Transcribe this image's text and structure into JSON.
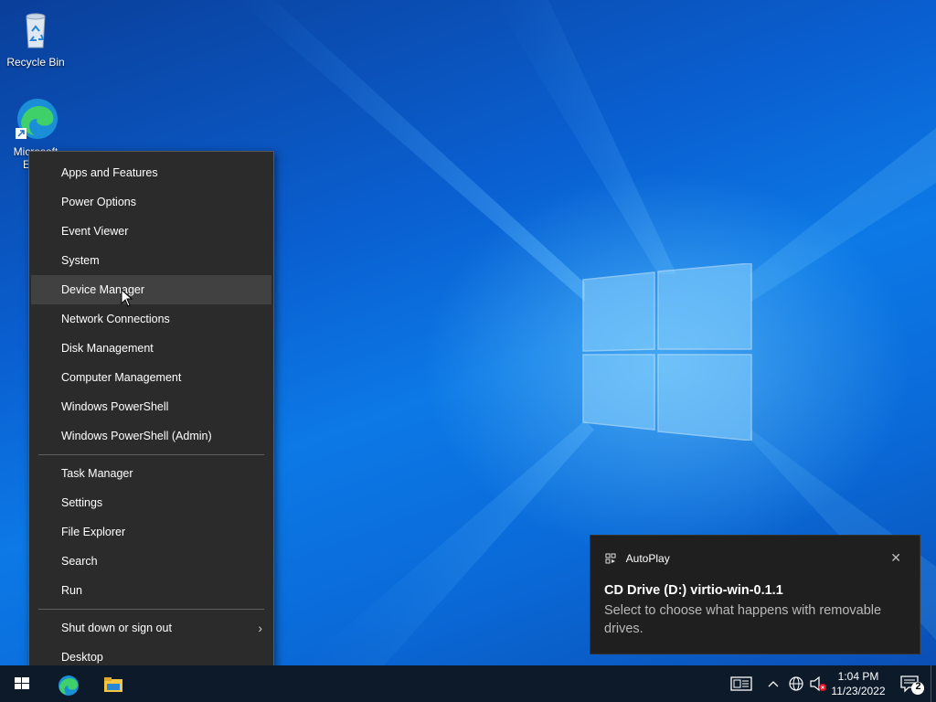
{
  "desktop": {
    "icons": [
      {
        "label": "Recycle Bin",
        "icon": "recycle-bin-icon"
      },
      {
        "label": "Microsoft Edge",
        "icon": "edge-icon"
      }
    ]
  },
  "context_menu": {
    "group1": [
      {
        "label": "Apps and Features"
      },
      {
        "label": "Power Options"
      },
      {
        "label": "Event Viewer"
      },
      {
        "label": "System"
      },
      {
        "label": "Device Manager",
        "highlighted": true
      },
      {
        "label": "Network Connections"
      },
      {
        "label": "Disk Management"
      },
      {
        "label": "Computer Management"
      },
      {
        "label": "Windows PowerShell"
      },
      {
        "label": "Windows PowerShell (Admin)"
      }
    ],
    "group2": [
      {
        "label": "Task Manager"
      },
      {
        "label": "Settings"
      },
      {
        "label": "File Explorer"
      },
      {
        "label": "Search"
      },
      {
        "label": "Run"
      }
    ],
    "group3": [
      {
        "label": "Shut down or sign out",
        "submenu_arrow": "chevron-right-icon"
      },
      {
        "label": "Desktop"
      }
    ]
  },
  "toast": {
    "app_name": "AutoPlay",
    "close_glyph": "✕",
    "title": "CD Drive (D:) virtio-win-0.1.1",
    "body": "Select to choose what happens with removable drives."
  },
  "taskbar": {
    "time": "1:04 PM",
    "date": "11/23/2022",
    "notification_count": "2",
    "colors": {
      "background": "#0c1a2a",
      "menu_bg": "#2b2b2b",
      "hover": "#414141",
      "accent": "#0a5fd0"
    }
  }
}
